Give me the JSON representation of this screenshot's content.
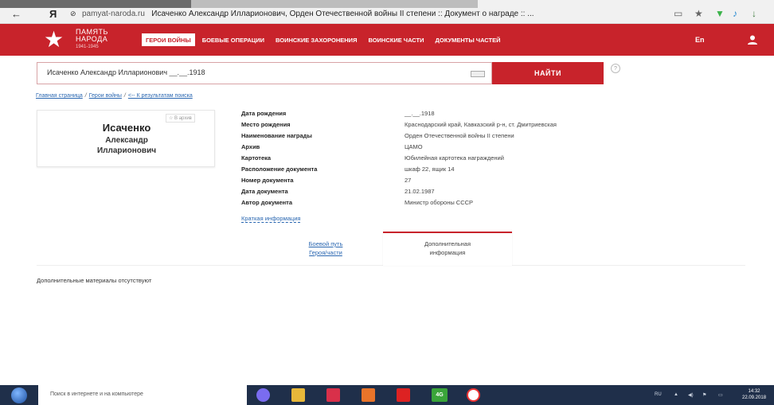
{
  "browser": {
    "back_icon": "arrow-left-icon",
    "yandex_label": "Я",
    "domain": "pamyat-naroda.ru",
    "title": "Исаченко Александр Илларионович, Орден Отечественной войны II степени :: Документ о награде :: ..."
  },
  "site": {
    "logo_line1": "ПАМЯТЬ",
    "logo_line2": "НАРОДА",
    "logo_years": "1941-1945",
    "nav": [
      {
        "label": "ГЕРОИ ВОЙНЫ",
        "active": true
      },
      {
        "label": "БОЕВЫЕ ОПЕРАЦИИ",
        "active": false
      },
      {
        "label": "ВОИНСКИЕ ЗАХОРОНЕНИЯ",
        "active": false
      },
      {
        "label": "ВОИНСКИЕ ЧАСТИ",
        "active": false
      },
      {
        "label": "ДОКУМЕНТЫ ЧАСТЕЙ",
        "active": false
      }
    ],
    "lang": "En"
  },
  "search": {
    "value": "Исаченко Александр Илларионович __.__.1918",
    "button_label": "НАЙТИ",
    "help": "?"
  },
  "breadcrumb": {
    "home": "Главная страница",
    "heroes": "Герои войны",
    "back": "<-- К результатам поиска"
  },
  "hero": {
    "archive_label": "☆ В архив",
    "last_name": "Исаченко",
    "first_name": "Александр",
    "middle_name": "Илларионович"
  },
  "details": [
    {
      "label": "Дата рождения",
      "value": "__.__.1918"
    },
    {
      "label": "Место рождения",
      "value": "Краснодарский край, Кавказский р-н, ст. Дмитриевская"
    },
    {
      "label": "Наименование награды",
      "value": "Орден Отечественной войны II степени"
    },
    {
      "label": "Архив",
      "value": "ЦАМО"
    },
    {
      "label": "Картотека",
      "value": "Юбилейная картотека награждений"
    },
    {
      "label": "Расположение документа",
      "value": "шкаф 22, ящик 14"
    },
    {
      "label": "Номер документа",
      "value": "27"
    },
    {
      "label": "Дата документа",
      "value": "21.02.1987"
    },
    {
      "label": "Автор документа",
      "value": "Министр обороны СССР"
    }
  ],
  "short_info": "Краткая информация",
  "tabs": {
    "combat_path_line1": "Боевой путь",
    "combat_path_line2": "Героя/части",
    "additional_line1": "Дополнительная",
    "additional_line2": "информация"
  },
  "no_materials": "Дополнительные материалы отсутствуют",
  "taskbar": {
    "search_text": "Поиск в интернете и на компьютере",
    "lang": "RU",
    "time": "14:32",
    "date": "22.09.2018",
    "apps": [
      "cortana-icon",
      "file-explorer-icon",
      "kazakh-app-icon",
      "media-player-icon",
      "yandex-icon",
      "4g-icon",
      "yandex-browser-icon"
    ],
    "app_4g_label": "4G"
  }
}
